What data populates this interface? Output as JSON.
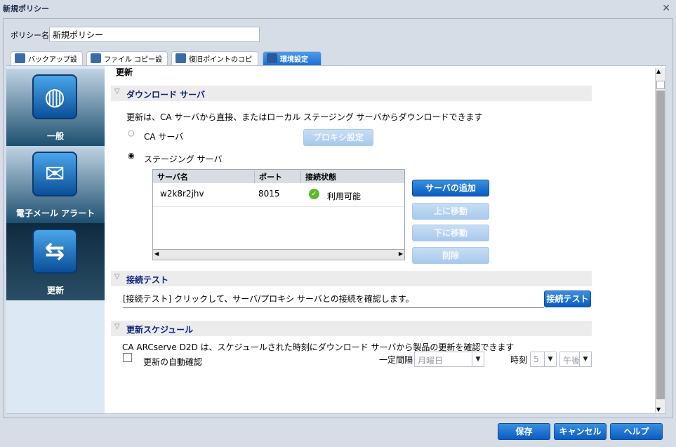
{
  "window": {
    "title": "新規ポリシー",
    "close": "✕"
  },
  "policy": {
    "label": "ポリシー名:",
    "value": "新規ポリシー"
  },
  "tabs": [
    "バックアップ設定",
    "ファイル コピー設定",
    "復旧ポイントのコピー",
    "環境設定"
  ],
  "sidebar": [
    {
      "label": "一般",
      "icon": "globe-icon"
    },
    {
      "label": "電子メール アラート",
      "icon": "mail-alert-icon"
    },
    {
      "label": "更新",
      "icon": "arrows-icon"
    }
  ],
  "main": {
    "heading": "更新",
    "download": {
      "title": "ダウンロード サーバ",
      "desc": "更新は、CA サーバから直接、またはローカル ステージング サーバからダウンロードできます",
      "ca": "CA サーバ",
      "proxy": "プロキシ設定",
      "staging": "ステージング サーバ",
      "columns": [
        "サーバ名",
        "ポート",
        "接続状態"
      ],
      "rows": [
        {
          "name": "w2k8r2jhv",
          "port": "8015",
          "status": "利用可能"
        }
      ],
      "add": "サーバの追加",
      "up": "上に移動",
      "down": "下に移動",
      "delete": "削除"
    },
    "test": {
      "title": "接続テスト",
      "desc": "[接続テスト] クリックして、サーバ/プロキシ サーバとの接続を確認します。",
      "button": "接続テスト"
    },
    "schedule": {
      "title": "更新スケジュール",
      "desc": "CA ARCserve D2D は、スケジュールされた時刻にダウンロード サーバから製品の更新を確認できます",
      "auto": "更新の自動確認",
      "interval_label": "一定間隔",
      "interval": "月曜日",
      "time_label": "時刻",
      "hour": "5",
      "ampm": "午後"
    }
  },
  "footer": {
    "save": "保存",
    "cancel": "キャンセル",
    "help": "ヘルプ"
  }
}
